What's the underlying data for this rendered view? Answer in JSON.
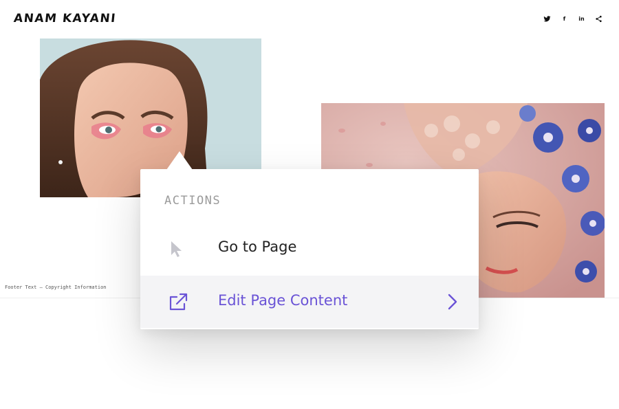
{
  "header": {
    "site_title": "ANAM KAYANI",
    "social_icons": [
      "twitter-icon",
      "facebook-icon",
      "linkedin-icon",
      "share-icon"
    ],
    "social_glyphs": {
      "twitter": "🐦",
      "facebook": "f",
      "linkedin": "in",
      "share": "<"
    }
  },
  "gallery": {
    "images": [
      "portrait-with-pink-eye-makeup",
      "bride-with-floral-headpiece"
    ]
  },
  "footer": {
    "text": "Footer Text – Copyright Information"
  },
  "popover": {
    "heading": "ACTIONS",
    "items": [
      {
        "label": "Go to Page",
        "icon": "cursor-pointer-icon"
      },
      {
        "label": "Edit Page Content",
        "icon": "external-link-icon",
        "has_submenu": true
      }
    ]
  },
  "colors": {
    "accent": "#6a53d6",
    "heading_gray": "#9a9a9a",
    "hover_row_bg": "#f4f4f6"
  }
}
